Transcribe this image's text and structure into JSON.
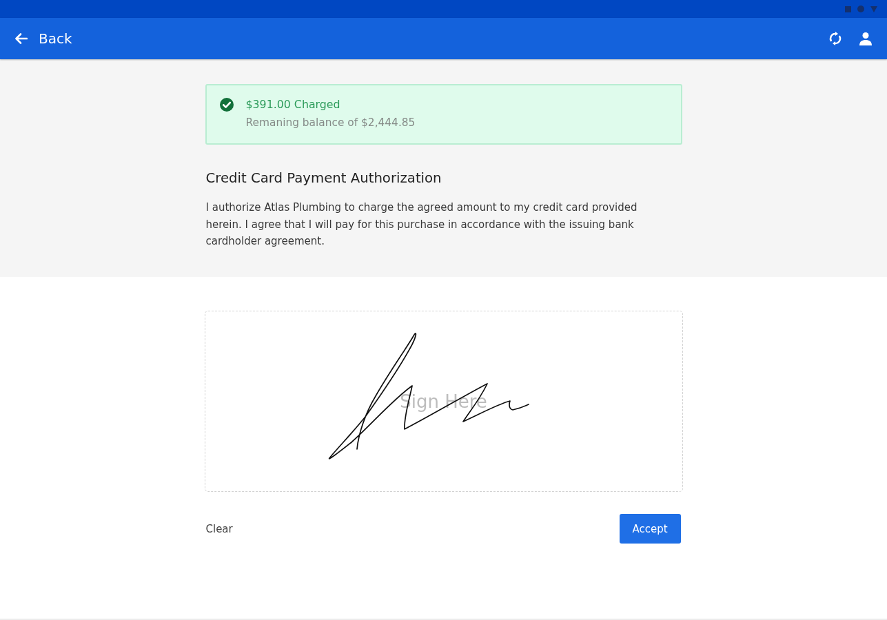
{
  "app_bar": {
    "back_label": "Back"
  },
  "alert": {
    "kind": "success",
    "title": "$391.00 Charged",
    "message": "Remaning balance of $2,444.85"
  },
  "authorization": {
    "title": "Credit Card Payment Authorization",
    "body": "I authorize Atlas Plumbing to charge the agreed amount to my credit card provided herein. I agree that I will pay for this purchase in accordance with the issuing bank cardholder agreement."
  },
  "signature_pad": {
    "placeholder": "Sign Here",
    "signed": true
  },
  "actions": [
    {
      "kind": "text",
      "label": "Clear"
    },
    {
      "kind": "primary",
      "label": "Accept"
    }
  ]
}
